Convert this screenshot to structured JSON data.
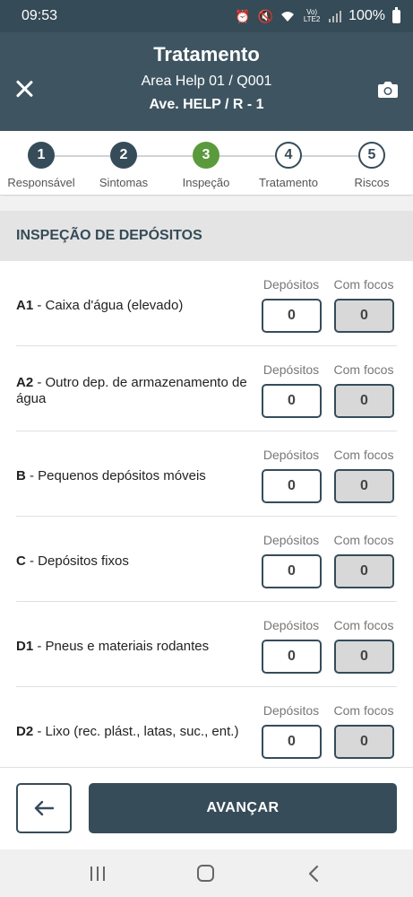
{
  "status_bar": {
    "time": "09:53",
    "network_label": "Vo) LTE2",
    "battery": "100%"
  },
  "header": {
    "title": "Tratamento",
    "subtitle_line1": "Area Help 01 / Q001",
    "subtitle_line2": "Ave. HELP / R - 1"
  },
  "stepper": {
    "current_step": 3,
    "steps": [
      {
        "number": "1",
        "label": "Responsável",
        "state": "done"
      },
      {
        "number": "2",
        "label": "Sintomas",
        "state": "done"
      },
      {
        "number": "3",
        "label": "Inspeção",
        "state": "current"
      },
      {
        "number": "4",
        "label": "Tratamento",
        "state": "todo"
      },
      {
        "number": "5",
        "label": "Riscos",
        "state": "todo"
      }
    ]
  },
  "section": {
    "title": "INSPEÇÃO DE DEPÓSITOS",
    "column_depositos": "Depósitos",
    "column_com_focos": "Com focos"
  },
  "items": [
    {
      "code": "A1",
      "description": " - Caixa d'água (elevado)",
      "depositos": "0",
      "com_focos": "0"
    },
    {
      "code": "A2",
      "description": " - Outro dep. de armazenamento de água",
      "depositos": "0",
      "com_focos": "0"
    },
    {
      "code": "B",
      "description": " - Pequenos depósitos móveis",
      "depositos": "0",
      "com_focos": "0"
    },
    {
      "code": "C",
      "description": " - Depósitos fixos",
      "depositos": "0",
      "com_focos": "0"
    },
    {
      "code": "D1",
      "description": " - Pneus e materiais rodantes",
      "depositos": "0",
      "com_focos": "0"
    },
    {
      "code": "D2",
      "description": " - Lixo (rec. plást., latas, suc., ent.)",
      "depositos": "0",
      "com_focos": "0"
    }
  ],
  "footer": {
    "advance_label": "AVANÇAR"
  },
  "colors": {
    "primary": "#364c59",
    "header_bg": "#3e5561",
    "current_step": "#5a9a3c",
    "section_bg": "#e4e4e4"
  },
  "icons": {
    "close": "close-icon",
    "camera": "camera-icon",
    "back": "arrow-left-icon",
    "nav_recent": "recent-apps-icon",
    "nav_home": "home-icon",
    "nav_back": "nav-back-icon"
  }
}
